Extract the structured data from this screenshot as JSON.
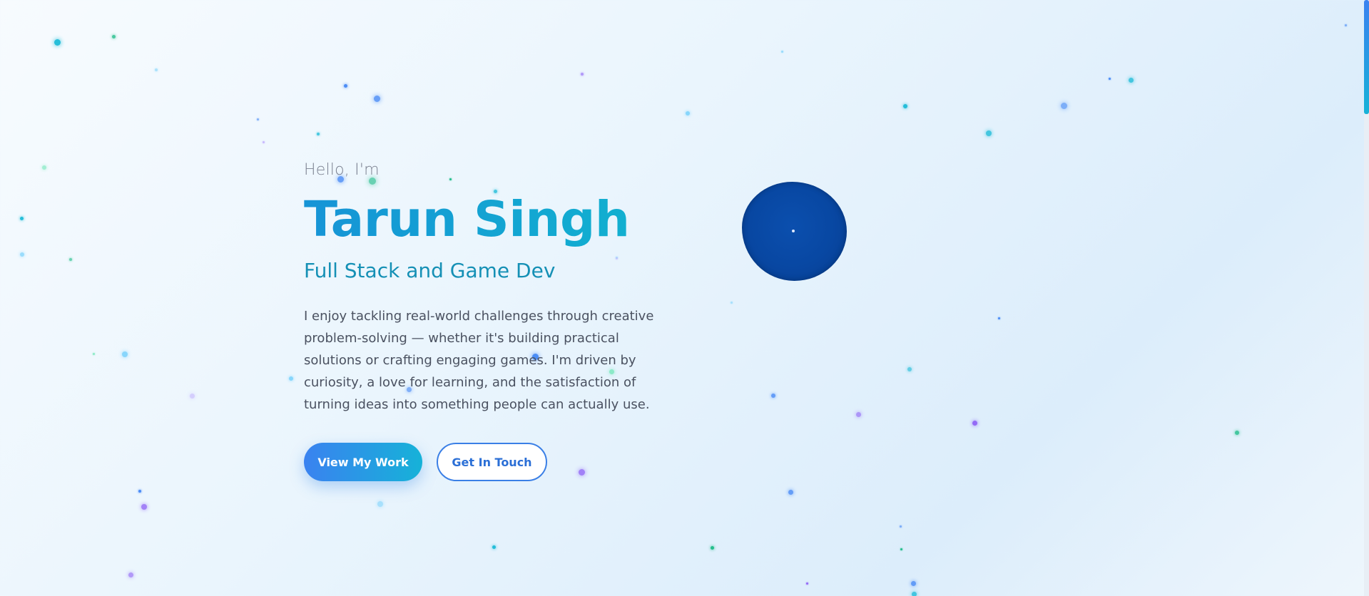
{
  "hero": {
    "greeting": "Hello, I'm",
    "name": "Tarun Singh",
    "role": "Full Stack and Game Dev",
    "bio": "I enjoy tackling real-world challenges through creative problem-solving — whether it's building practical solutions or crafting engaging games. I'm driven by curiosity, a love for learning, and the satisfaction of turning ideas into something people can actually use."
  },
  "actions": {
    "primary_label": "View My Work",
    "secondary_label": "Get In Touch"
  },
  "colors": {
    "accent_blue": "#3a82f0",
    "accent_cyan": "#16b2d8",
    "blob_blue": "#0847a2",
    "particle_palette": [
      "#10b8d6",
      "#3b82f6",
      "#10b981",
      "#8b5cf6",
      "#7dd3fc",
      "#c4b5fd",
      "#6ee7b7"
    ]
  }
}
